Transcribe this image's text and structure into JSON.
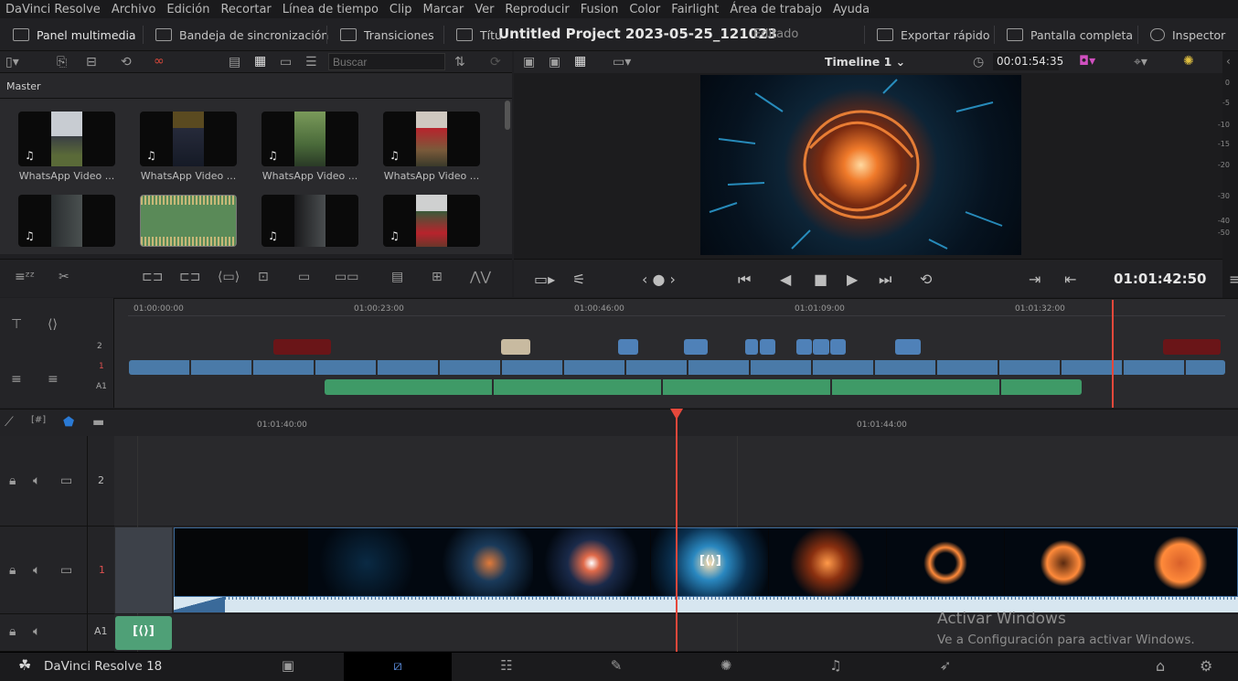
{
  "menu": [
    "DaVinci Resolve",
    "Archivo",
    "Edición",
    "Recortar",
    "Línea de tiempo",
    "Clip",
    "Marcar",
    "Ver",
    "Reproducir",
    "Fusion",
    "Color",
    "Fairlight",
    "Área de trabajo",
    "Ayuda"
  ],
  "toolbar": {
    "media_pool": "Panel multimedia",
    "sync_bin": "Bandeja de sincronización",
    "transitions": "Transiciones",
    "titles": "Títu",
    "project_title": "Untitled Project 2023-05-25_121023",
    "project_status": "Editado",
    "quick_export": "Exportar rápido",
    "fullscreen": "Pantalla completa",
    "inspector": "Inspector"
  },
  "media": {
    "search_placeholder": "Buscar",
    "bin": "Master",
    "clips": [
      "WhatsApp Video ...",
      "WhatsApp Video ...",
      "WhatsApp Video ...",
      "WhatsApp Video ..."
    ]
  },
  "viewer": {
    "timeline_name": "Timeline 1",
    "duration": "00:01:54:35",
    "timecode": "01:01:42:50"
  },
  "meter": [
    "0",
    "-5",
    "-10",
    "-15",
    "-20",
    "-30",
    "-40",
    "-50"
  ],
  "mini_timeline": {
    "ruler": [
      "01:00:00:00",
      "01:00:23:00",
      "01:00:46:00",
      "01:01:09:00",
      "01:01:32:00"
    ],
    "tracks": [
      "2",
      "1",
      "A1"
    ]
  },
  "timeline": {
    "ruler": [
      "01:01:40:00",
      "01:01:44:00"
    ],
    "tracks": [
      "2",
      "1",
      "A1"
    ]
  },
  "watermark": {
    "line1": "Activar Windows",
    "line2": "Ve a Configuración para activar Windows."
  },
  "footer": {
    "brand": "DaVinci Resolve 18"
  }
}
